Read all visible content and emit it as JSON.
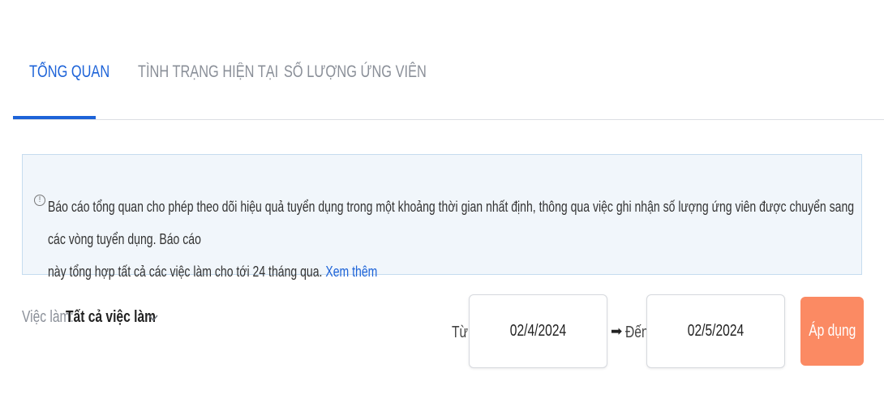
{
  "tabs": [
    {
      "label": "TỔNG QUAN",
      "active": true
    },
    {
      "label": "TÌNH TRẠNG HIỆN TẠI",
      "active": false
    },
    {
      "label": "SỐ LƯỢNG ỨNG VIÊN",
      "active": false
    }
  ],
  "info": {
    "icon": "info-circle-icon",
    "line1": "Báo cáo tổng quan cho phép theo dõi hiệu quả tuyển dụng trong một khoảng thời gian nhất định, thông qua việc ghi nhận số lượng ứng viên được chuyển sang các vòng tuyển dụng. Báo cáo",
    "line2": "này tổng hợp tất cả các việc làm cho tới 24 tháng qua.",
    "link": "Xem thêm"
  },
  "filters": {
    "job_label": "Việc làm:",
    "job_value": "Tất cả việc làm",
    "from_label": "Từ:",
    "from_date": "02/4/2024",
    "to_label": "Đến:",
    "to_date": "02/5/2024",
    "apply_label": "Áp dụng"
  },
  "colors": {
    "accent": "#1d63d8",
    "apply_button": "#fb8a63",
    "info_bg": "#f1f6fb"
  }
}
